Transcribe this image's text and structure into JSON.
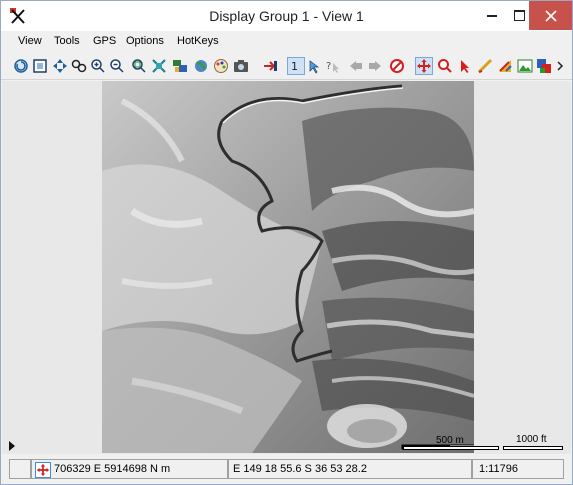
{
  "window": {
    "title": "Display Group 1 - View 1"
  },
  "menu": {
    "items": [
      "View",
      "Tools",
      "GPS",
      "Options",
      "HotKeys"
    ]
  },
  "toolbar": {
    "icons": [
      "redraw-icon",
      "full-view-icon",
      "zoom-extent-icon",
      "zoom-region-icon",
      "zoom-in-icon",
      "zoom-out-icon",
      "zoom-box-icon",
      "zoom-fit-icon",
      "layer-manager-icon",
      "globe-icon",
      "palette-icon",
      "snapshot-icon",
      "add-layer-icon",
      "select-object-icon",
      "select-node-icon",
      "help-pointer-icon",
      "previous-view-icon",
      "next-view-icon",
      "cancel-icon",
      "pan-icon",
      "zoom-tool-icon",
      "pointer-icon",
      "measure-icon",
      "sketch-icon",
      "image-icon",
      "layers-icon",
      "more-icon"
    ]
  },
  "map": {
    "scalebar_metric_label": "500 m",
    "scalebar_imperial_label": "1000 ft"
  },
  "status": {
    "projected_coords": "706329 E  5914698 N m",
    "geographic_coords": "E 149 18 55.6  S 36 53 28.2",
    "scale": "1:11796"
  }
}
